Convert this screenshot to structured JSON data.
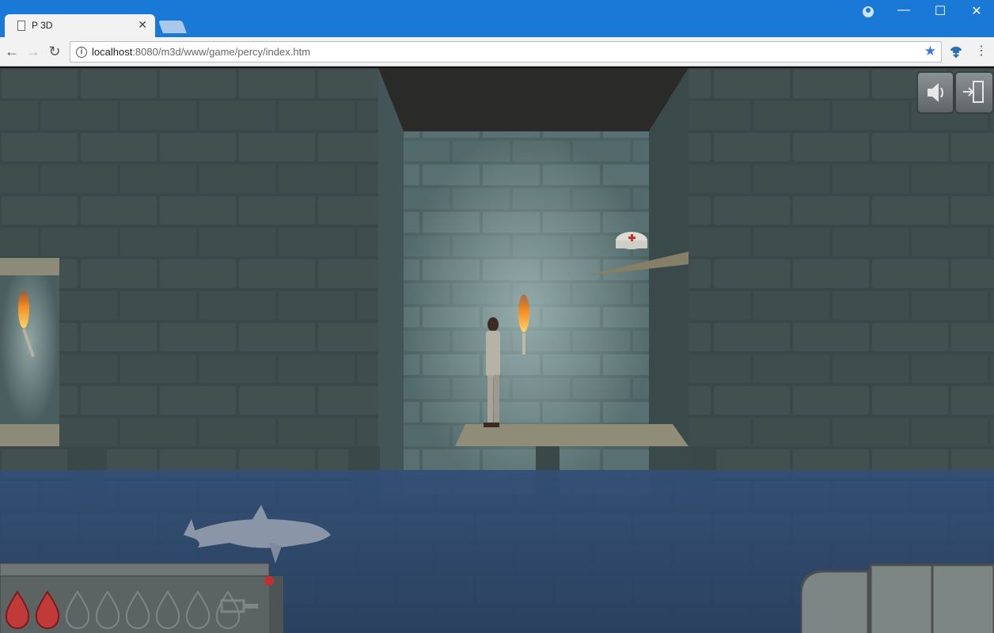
{
  "browser": {
    "tab_title": "P 3D",
    "tab_close": "✕",
    "url_host": "localhost",
    "url_path": ":8080/m3d/www/game/percy/index.htm",
    "window_controls": {
      "minimize": "—",
      "maximize": "☐",
      "close": "✕"
    },
    "nav": {
      "back": "←",
      "forward": "→",
      "reload": "↻"
    },
    "icons": [
      "doc-icon",
      "profile-icon",
      "info-icon",
      "star-icon",
      "extension-icon",
      "menu-icon"
    ],
    "accent_color": "#1a78d6"
  },
  "game": {
    "hud": {
      "sound_button_icon": "speaker-icon",
      "exit_button_icon": "exit-door-icon",
      "health": {
        "filled": 2,
        "total": 8
      },
      "key_icon": "key-icon"
    },
    "scene": {
      "objects": [
        "player-character",
        "torch-left",
        "torch-center",
        "health-potion",
        "shark",
        "stone-ledge-left",
        "stone-ledge-center",
        "stone-ledge-upper"
      ],
      "water_color": "#2c4a78",
      "stone_color": "#3d4c4d"
    }
  }
}
